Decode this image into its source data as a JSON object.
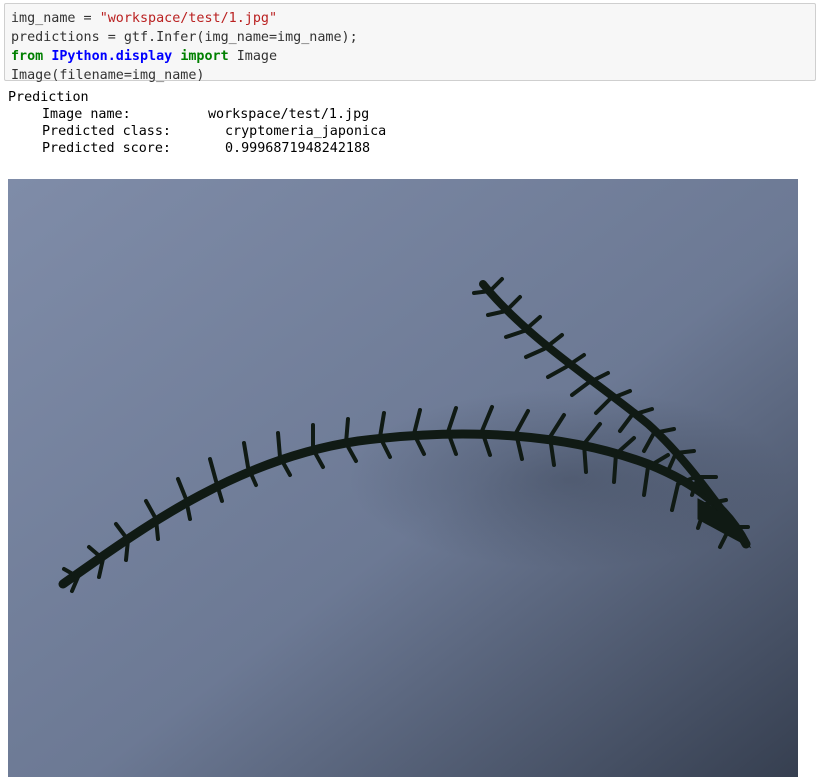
{
  "code": {
    "line1_var": "img_name = ",
    "line1_str": "\"workspace/test/1.jpg\"",
    "line2": "predictions = gtf.Infer(img_name=img_name);",
    "line3_from": "from",
    "line3_module": "IPython.display",
    "line3_import": "import",
    "line3_name": "Image",
    "line4": "Image(filename=img_name)"
  },
  "output": {
    "heading": "Prediction",
    "rows": [
      {
        "label": "Image name:",
        "value": "workspace/test/1.jpg"
      },
      {
        "label": "Predicted class:",
        "value": "cryptomeria_japonica"
      },
      {
        "label": "Predicted score:",
        "value": "0.9996871948242188"
      }
    ]
  },
  "colors": {
    "background_top": "#7d8aa6",
    "background_bottom": "#3f4a5c",
    "branch": "#101a14"
  }
}
